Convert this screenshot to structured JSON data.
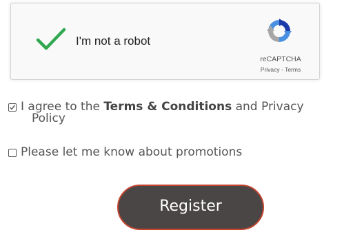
{
  "recaptcha": {
    "label": "I'm not a robot",
    "brand": "reCAPTCHA",
    "privacy": "Privacy",
    "separator": " - ",
    "terms": "Terms",
    "checked": true,
    "check_color": "#2fa84f"
  },
  "agree": {
    "checked": true,
    "prefix": "I agree to the ",
    "terms_link": "Terms & Conditions",
    "middle": " and Privacy",
    "privacy_link": "Policy"
  },
  "promotions": {
    "checked": false,
    "label": "Please let me know about promotions"
  },
  "register": {
    "label": "Register",
    "bg_color": "#4a4646",
    "border_color": "#c2442f"
  }
}
